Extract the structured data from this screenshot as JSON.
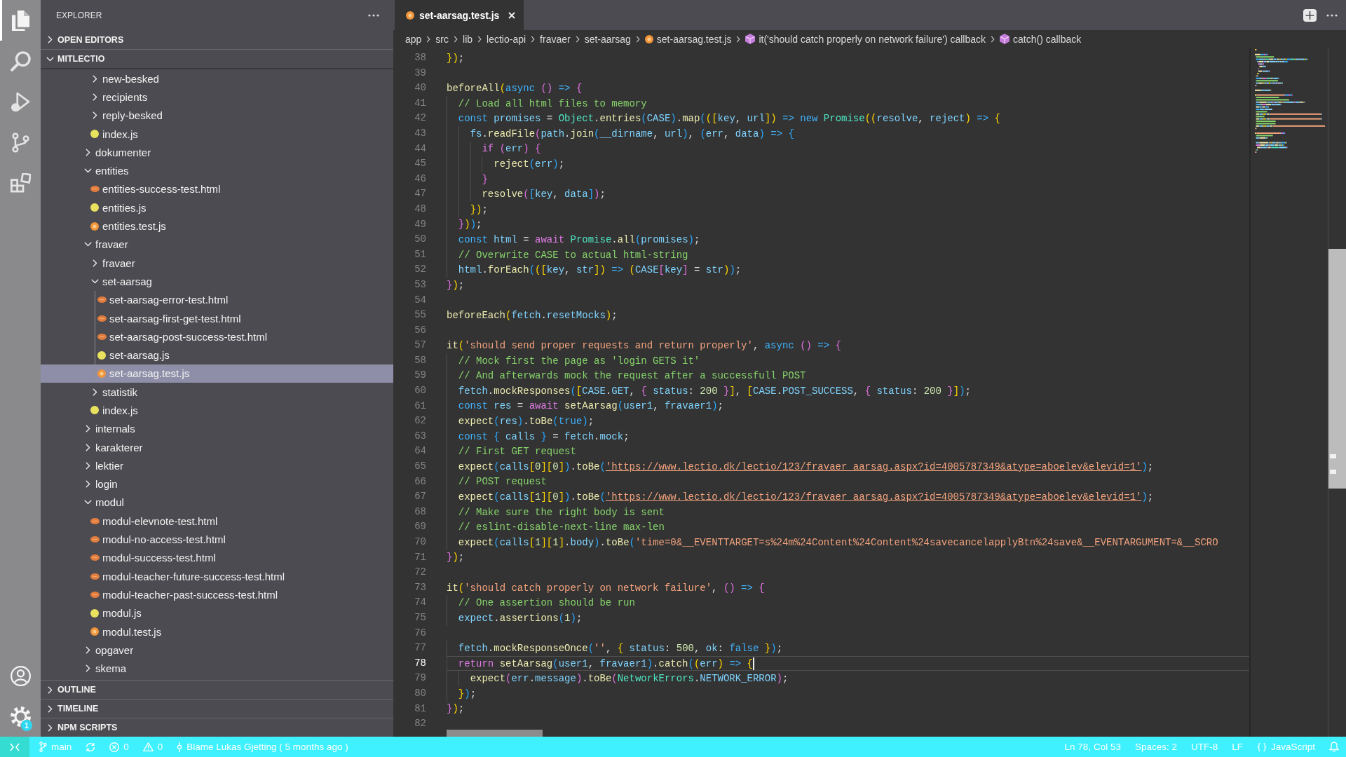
{
  "activity_bar": {
    "items": [
      {
        "kind": "files",
        "selected": true
      },
      {
        "kind": "search",
        "selected": false
      },
      {
        "kind": "debug",
        "selected": false
      },
      {
        "kind": "git",
        "selected": false
      },
      {
        "kind": "extensions",
        "selected": false
      }
    ],
    "bottom": [
      {
        "kind": "accounts"
      },
      {
        "kind": "settings",
        "badge": "1"
      }
    ]
  },
  "sidebar": {
    "title": "EXPLORER",
    "sections": [
      {
        "title": "OPEN EDITORS",
        "expanded": false
      },
      {
        "title": "MITLECTIO",
        "expanded": true,
        "tree": {
          "continued": [
            {
              "name": "new-besked",
              "kind": "folder",
              "expanded": false,
              "selected": false
            },
            {
              "name": "recipients",
              "kind": "folder",
              "expanded": false,
              "selected": false
            },
            {
              "name": "reply-besked",
              "kind": "folder",
              "expanded": false,
              "selected": false
            },
            {
              "name": "index.js",
              "kind": "js",
              "selected": false
            }
          ],
          "items": [
            {
              "name": "dokumenter",
              "kind": "folder",
              "expanded": false,
              "selected": false
            },
            {
              "name": "entities",
              "kind": "folder",
              "expanded": true,
              "selected": false,
              "children": [
                {
                  "name": "entities-success-test.html",
                  "kind": "html",
                  "selected": false
                },
                {
                  "name": "entities.js",
                  "kind": "js",
                  "selected": false
                },
                {
                  "name": "entities.test.js",
                  "kind": "test",
                  "selected": false
                }
              ]
            },
            {
              "name": "fravaer",
              "kind": "folder",
              "expanded": true,
              "selected": false,
              "children": [
                {
                  "name": "fravaer",
                  "kind": "folder",
                  "expanded": false,
                  "selected": false
                },
                {
                  "name": "set-aarsag",
                  "kind": "folder",
                  "expanded": true,
                  "selected": false,
                  "children": [
                    {
                      "name": "set-aarsag-error-test.html",
                      "kind": "html",
                      "selected": false
                    },
                    {
                      "name": "set-aarsag-first-get-test.html",
                      "kind": "html",
                      "selected": false
                    },
                    {
                      "name": "set-aarsag-post-success-test.html",
                      "kind": "html",
                      "selected": false
                    },
                    {
                      "name": "set-aarsag.js",
                      "kind": "js",
                      "selected": false
                    },
                    {
                      "name": "set-aarsag.test.js",
                      "kind": "test",
                      "selected": true
                    }
                  ]
                },
                {
                  "name": "statistik",
                  "kind": "folder",
                  "expanded": false,
                  "selected": false
                },
                {
                  "name": "index.js",
                  "kind": "js",
                  "selected": false
                }
              ]
            },
            {
              "name": "internals",
              "kind": "folder",
              "expanded": false,
              "selected": false
            },
            {
              "name": "karakterer",
              "kind": "folder",
              "expanded": false,
              "selected": false
            },
            {
              "name": "lektier",
              "kind": "folder",
              "expanded": false,
              "selected": false
            },
            {
              "name": "login",
              "kind": "folder",
              "expanded": false,
              "selected": false
            },
            {
              "name": "modul",
              "kind": "folder",
              "expanded": true,
              "selected": false,
              "children": [
                {
                  "name": "modul-elevnote-test.html",
                  "kind": "html",
                  "selected": false
                },
                {
                  "name": "modul-no-access-test.html",
                  "kind": "html",
                  "selected": false
                },
                {
                  "name": "modul-success-test.html",
                  "kind": "html",
                  "selected": false
                },
                {
                  "name": "modul-teacher-future-success-test.html",
                  "kind": "html",
                  "selected": false
                },
                {
                  "name": "modul-teacher-past-success-test.html",
                  "kind": "html",
                  "selected": false
                },
                {
                  "name": "modul.js",
                  "kind": "js",
                  "selected": false
                },
                {
                  "name": "modul.test.js",
                  "kind": "test",
                  "selected": false
                }
              ]
            },
            {
              "name": "opgaver",
              "kind": "folder",
              "expanded": false,
              "selected": false
            },
            {
              "name": "skema",
              "kind": "folder",
              "expanded": false,
              "selected": false
            }
          ]
        }
      },
      {
        "title": "OUTLINE",
        "expanded": false
      },
      {
        "title": "TIMELINE",
        "expanded": false
      },
      {
        "title": "NPM SCRIPTS",
        "expanded": false
      }
    ]
  },
  "editor": {
    "tabs": [
      {
        "label": "set-aarsag.test.js",
        "kind": "test",
        "selected": true
      }
    ],
    "breadcrumbs": [
      {
        "label": "app",
        "kind": "folder"
      },
      {
        "label": "src",
        "kind": "folder"
      },
      {
        "label": "lib",
        "kind": "folder"
      },
      {
        "label": "lectio-api",
        "kind": "folder"
      },
      {
        "label": "fravaer",
        "kind": "folder"
      },
      {
        "label": "set-aarsag",
        "kind": "folder"
      },
      {
        "label": "set-aarsag.test.js",
        "kind": "test"
      },
      {
        "label": "it('should catch properly on network failure') callback",
        "kind": "method"
      },
      {
        "label": "catch() callback",
        "kind": "method"
      }
    ],
    "lines": [
      {
        "number": "38",
        "current": false,
        "tokens": [
          {
            "kind": "br1",
            "text": "})"
          },
          {
            "kind": "p",
            "text": ";"
          }
        ]
      },
      {
        "number": "39",
        "current": false
      },
      {
        "number": "40",
        "current": false,
        "tokens": [
          {
            "kind": "fn",
            "text": "beforeAll"
          },
          {
            "kind": "br1",
            "text": "("
          },
          {
            "kind": "kw",
            "text": "async "
          },
          {
            "kind": "br2",
            "text": "() "
          },
          {
            "kind": "kw",
            "text": "=> "
          },
          {
            "kind": "br2",
            "text": "{"
          }
        ]
      },
      {
        "number": "41",
        "current": false,
        "tokens": [
          {
            "kind": "cmt",
            "text": "  // Load all html files to memory"
          }
        ]
      },
      {
        "number": "42",
        "current": false,
        "tokens": [
          {
            "kind": "kw",
            "text": "  const "
          },
          {
            "kind": "var",
            "text": "promises"
          },
          {
            "kind": "p",
            "text": " = "
          },
          {
            "kind": "type",
            "text": "Object"
          },
          {
            "kind": "p",
            "text": "."
          },
          {
            "kind": "fn",
            "text": "entries"
          },
          {
            "kind": "br3",
            "text": "("
          },
          {
            "kind": "var",
            "text": "CASE"
          },
          {
            "kind": "br3",
            "text": ")"
          },
          {
            "kind": "p",
            "text": "."
          },
          {
            "kind": "fn",
            "text": "map"
          },
          {
            "kind": "br3",
            "text": "("
          },
          {
            "kind": "br1",
            "text": "(["
          },
          {
            "kind": "var",
            "text": "key"
          },
          {
            "kind": "p",
            "text": ", "
          },
          {
            "kind": "var",
            "text": "url"
          },
          {
            "kind": "br1",
            "text": "]) "
          },
          {
            "kind": "kw",
            "text": "=> new "
          },
          {
            "kind": "type",
            "text": "Promise"
          },
          {
            "kind": "br1",
            "text": "(("
          },
          {
            "kind": "var",
            "text": "resolve"
          },
          {
            "kind": "p",
            "text": ", "
          },
          {
            "kind": "var",
            "text": "reject"
          },
          {
            "kind": "br1",
            "text": ") "
          },
          {
            "kind": "kw",
            "text": "=> "
          },
          {
            "kind": "br1",
            "text": "{"
          }
        ]
      },
      {
        "number": "43",
        "current": false,
        "tokens": [
          {
            "kind": "var",
            "text": "    fs"
          },
          {
            "kind": "p",
            "text": "."
          },
          {
            "kind": "fn",
            "text": "readFile"
          },
          {
            "kind": "br2",
            "text": "("
          },
          {
            "kind": "var",
            "text": "path"
          },
          {
            "kind": "p",
            "text": "."
          },
          {
            "kind": "fn",
            "text": "join"
          },
          {
            "kind": "br3",
            "text": "("
          },
          {
            "kind": "var",
            "text": "__dirname"
          },
          {
            "kind": "p",
            "text": ", "
          },
          {
            "kind": "var",
            "text": "url"
          },
          {
            "kind": "br3",
            "text": ")"
          },
          {
            "kind": "p",
            "text": ", "
          },
          {
            "kind": "br3",
            "text": "("
          },
          {
            "kind": "var",
            "text": "err"
          },
          {
            "kind": "p",
            "text": ", "
          },
          {
            "kind": "var",
            "text": "data"
          },
          {
            "kind": "br3",
            "text": ") "
          },
          {
            "kind": "kw",
            "text": "=> "
          },
          {
            "kind": "br3",
            "text": "{"
          }
        ]
      },
      {
        "number": "44",
        "current": false,
        "tokens": [
          {
            "kind": "ctrl",
            "text": "      if "
          },
          {
            "kind": "br2",
            "text": "("
          },
          {
            "kind": "var",
            "text": "err"
          },
          {
            "kind": "br2",
            "text": ") {"
          }
        ]
      },
      {
        "number": "45",
        "current": false,
        "tokens": [
          {
            "kind": "fn",
            "text": "        reject"
          },
          {
            "kind": "br3",
            "text": "("
          },
          {
            "kind": "var",
            "text": "err"
          },
          {
            "kind": "br3",
            "text": ")"
          },
          {
            "kind": "p",
            "text": ";"
          }
        ]
      },
      {
        "number": "46",
        "current": false,
        "tokens": [
          {
            "kind": "br2",
            "text": "      }"
          }
        ]
      },
      {
        "number": "47",
        "current": false,
        "tokens": [
          {
            "kind": "fn",
            "text": "      resolve"
          },
          {
            "kind": "br2",
            "text": "("
          },
          {
            "kind": "br3",
            "text": "["
          },
          {
            "kind": "var",
            "text": "key"
          },
          {
            "kind": "p",
            "text": ", "
          },
          {
            "kind": "var",
            "text": "data"
          },
          {
            "kind": "br3",
            "text": "]"
          },
          {
            "kind": "br2",
            "text": ")"
          },
          {
            "kind": "p",
            "text": ";"
          }
        ]
      },
      {
        "number": "48",
        "current": false,
        "tokens": [
          {
            "kind": "br1",
            "text": "    })"
          },
          {
            "kind": "p",
            "text": ";"
          }
        ]
      },
      {
        "number": "49",
        "current": false,
        "tokens": [
          {
            "kind": "br2",
            "text": "  }"
          },
          {
            "kind": "br1",
            "text": ")"
          },
          {
            "kind": "br3",
            "text": ")"
          },
          {
            "kind": "p",
            "text": ";"
          }
        ]
      },
      {
        "number": "50",
        "current": false,
        "tokens": [
          {
            "kind": "kw",
            "text": "  const "
          },
          {
            "kind": "var",
            "text": "html"
          },
          {
            "kind": "p",
            "text": " = "
          },
          {
            "kind": "ctrl",
            "text": "await "
          },
          {
            "kind": "type",
            "text": "Promise"
          },
          {
            "kind": "p",
            "text": "."
          },
          {
            "kind": "fn",
            "text": "all"
          },
          {
            "kind": "br3",
            "text": "("
          },
          {
            "kind": "var",
            "text": "promises"
          },
          {
            "kind": "br3",
            "text": ")"
          },
          {
            "kind": "p",
            "text": ";"
          }
        ]
      },
      {
        "number": "51",
        "current": false,
        "tokens": [
          {
            "kind": "cmt",
            "text": "  // Overwrite CASE to actual html-string"
          }
        ]
      },
      {
        "number": "52",
        "current": false,
        "tokens": [
          {
            "kind": "var",
            "text": "  html"
          },
          {
            "kind": "p",
            "text": "."
          },
          {
            "kind": "fn",
            "text": "forEach"
          },
          {
            "kind": "br3",
            "text": "("
          },
          {
            "kind": "br1",
            "text": "(["
          },
          {
            "kind": "var",
            "text": "key"
          },
          {
            "kind": "p",
            "text": ", "
          },
          {
            "kind": "var",
            "text": "str"
          },
          {
            "kind": "br1",
            "text": "]) "
          },
          {
            "kind": "kw",
            "text": "=> "
          },
          {
            "kind": "br1",
            "text": "("
          },
          {
            "kind": "var",
            "text": "CASE"
          },
          {
            "kind": "br2",
            "text": "["
          },
          {
            "kind": "var",
            "text": "key"
          },
          {
            "kind": "br2",
            "text": "]"
          },
          {
            "kind": "p",
            "text": " = "
          },
          {
            "kind": "var",
            "text": "str"
          },
          {
            "kind": "br1",
            "text": ")"
          },
          {
            "kind": "br3",
            "text": ")"
          },
          {
            "kind": "p",
            "text": ";"
          }
        ]
      },
      {
        "number": "53",
        "current": false,
        "tokens": [
          {
            "kind": "br2",
            "text": "}"
          },
          {
            "kind": "br1",
            "text": ")"
          },
          {
            "kind": "p",
            "text": ";"
          }
        ]
      },
      {
        "number": "54",
        "current": false
      },
      {
        "number": "55",
        "current": false,
        "tokens": [
          {
            "kind": "fn",
            "text": "beforeEach"
          },
          {
            "kind": "br1",
            "text": "("
          },
          {
            "kind": "var",
            "text": "fetch"
          },
          {
            "kind": "p",
            "text": "."
          },
          {
            "kind": "var",
            "text": "resetMocks"
          },
          {
            "kind": "br1",
            "text": ")"
          },
          {
            "kind": "p",
            "text": ";"
          }
        ]
      },
      {
        "number": "56",
        "current": false
      },
      {
        "number": "57",
        "current": false,
        "tokens": [
          {
            "kind": "fn",
            "text": "it"
          },
          {
            "kind": "br1",
            "text": "("
          },
          {
            "kind": "str",
            "text": "'should send proper requests and return properly'"
          },
          {
            "kind": "p",
            "text": ", "
          },
          {
            "kind": "kw",
            "text": "async "
          },
          {
            "kind": "br2",
            "text": "() "
          },
          {
            "kind": "kw",
            "text": "=> "
          },
          {
            "kind": "br2",
            "text": "{"
          }
        ]
      },
      {
        "number": "58",
        "current": false,
        "tokens": [
          {
            "kind": "cmt",
            "text": "  // Mock first the page as 'login GETS it'"
          }
        ]
      },
      {
        "number": "59",
        "current": false,
        "tokens": [
          {
            "kind": "cmt",
            "text": "  // And afterwards mock the request after a successfull POST"
          }
        ]
      },
      {
        "number": "60",
        "current": false,
        "tokens": [
          {
            "kind": "var",
            "text": "  fetch"
          },
          {
            "kind": "p",
            "text": "."
          },
          {
            "kind": "fn",
            "text": "mockResponses"
          },
          {
            "kind": "br3",
            "text": "("
          },
          {
            "kind": "br1",
            "text": "["
          },
          {
            "kind": "var",
            "text": "CASE"
          },
          {
            "kind": "p",
            "text": "."
          },
          {
            "kind": "var",
            "text": "GET"
          },
          {
            "kind": "p",
            "text": ", "
          },
          {
            "kind": "br2",
            "text": "{ "
          },
          {
            "kind": "var",
            "text": "status"
          },
          {
            "kind": "p",
            "text": ": "
          },
          {
            "kind": "num",
            "text": "200 "
          },
          {
            "kind": "br2",
            "text": "}"
          },
          {
            "kind": "br1",
            "text": "]"
          },
          {
            "kind": "p",
            "text": ", "
          },
          {
            "kind": "br1",
            "text": "["
          },
          {
            "kind": "var",
            "text": "CASE"
          },
          {
            "kind": "p",
            "text": "."
          },
          {
            "kind": "var",
            "text": "POST_SUCCESS"
          },
          {
            "kind": "p",
            "text": ", "
          },
          {
            "kind": "br2",
            "text": "{ "
          },
          {
            "kind": "var",
            "text": "status"
          },
          {
            "kind": "p",
            "text": ": "
          },
          {
            "kind": "num",
            "text": "200 "
          },
          {
            "kind": "br2",
            "text": "}"
          },
          {
            "kind": "br1",
            "text": "]"
          },
          {
            "kind": "br3",
            "text": ")"
          },
          {
            "kind": "p",
            "text": ";"
          }
        ]
      },
      {
        "number": "61",
        "current": false,
        "tokens": [
          {
            "kind": "kw",
            "text": "  const "
          },
          {
            "kind": "var",
            "text": "res"
          },
          {
            "kind": "p",
            "text": " = "
          },
          {
            "kind": "ctrl",
            "text": "await "
          },
          {
            "kind": "fn",
            "text": "setAarsag"
          },
          {
            "kind": "br3",
            "text": "("
          },
          {
            "kind": "var",
            "text": "user1"
          },
          {
            "kind": "p",
            "text": ", "
          },
          {
            "kind": "var",
            "text": "fravaer1"
          },
          {
            "kind": "br3",
            "text": ")"
          },
          {
            "kind": "p",
            "text": ";"
          }
        ]
      },
      {
        "number": "62",
        "current": false,
        "tokens": [
          {
            "kind": "fn",
            "text": "  expect"
          },
          {
            "kind": "br3",
            "text": "("
          },
          {
            "kind": "var",
            "text": "res"
          },
          {
            "kind": "br3",
            "text": ")"
          },
          {
            "kind": "p",
            "text": "."
          },
          {
            "kind": "fn",
            "text": "toBe"
          },
          {
            "kind": "br3",
            "text": "("
          },
          {
            "kind": "kw",
            "text": "true"
          },
          {
            "kind": "br3",
            "text": ")"
          },
          {
            "kind": "p",
            "text": ";"
          }
        ]
      },
      {
        "number": "63",
        "current": false,
        "tokens": [
          {
            "kind": "kw",
            "text": "  const "
          },
          {
            "kind": "br3",
            "text": "{ "
          },
          {
            "kind": "var",
            "text": "calls "
          },
          {
            "kind": "br3",
            "text": "}"
          },
          {
            "kind": "p",
            "text": " = "
          },
          {
            "kind": "var",
            "text": "fetch"
          },
          {
            "kind": "p",
            "text": "."
          },
          {
            "kind": "var",
            "text": "mock"
          },
          {
            "kind": "p",
            "text": ";"
          }
        ]
      },
      {
        "number": "64",
        "current": false,
        "tokens": [
          {
            "kind": "cmt",
            "text": "  // First GET request"
          }
        ]
      },
      {
        "number": "65",
        "current": false,
        "tokens": [
          {
            "kind": "fn",
            "text": "  expect"
          },
          {
            "kind": "br3",
            "text": "("
          },
          {
            "kind": "var",
            "text": "calls"
          },
          {
            "kind": "br1",
            "text": "["
          },
          {
            "kind": "num",
            "text": "0"
          },
          {
            "kind": "br1",
            "text": "]["
          },
          {
            "kind": "num",
            "text": "0"
          },
          {
            "kind": "br1",
            "text": "]"
          },
          {
            "kind": "br3",
            "text": ")"
          },
          {
            "kind": "p",
            "text": "."
          },
          {
            "kind": "fn",
            "text": "toBe"
          },
          {
            "kind": "br3",
            "text": "("
          },
          {
            "kind": "url",
            "text": "'https://www.lectio.dk/lectio/123/fravaer_aarsag.aspx?id=4005787349&atype=aboelev&elevid=1'"
          },
          {
            "kind": "br3",
            "text": ")"
          },
          {
            "kind": "p",
            "text": ";"
          }
        ]
      },
      {
        "number": "66",
        "current": false,
        "tokens": [
          {
            "kind": "cmt",
            "text": "  // POST request"
          }
        ]
      },
      {
        "number": "67",
        "current": false,
        "tokens": [
          {
            "kind": "fn",
            "text": "  expect"
          },
          {
            "kind": "br3",
            "text": "("
          },
          {
            "kind": "var",
            "text": "calls"
          },
          {
            "kind": "br1",
            "text": "["
          },
          {
            "kind": "num",
            "text": "1"
          },
          {
            "kind": "br1",
            "text": "]["
          },
          {
            "kind": "num",
            "text": "0"
          },
          {
            "kind": "br1",
            "text": "]"
          },
          {
            "kind": "br3",
            "text": ")"
          },
          {
            "kind": "p",
            "text": "."
          },
          {
            "kind": "fn",
            "text": "toBe"
          },
          {
            "kind": "br3",
            "text": "("
          },
          {
            "kind": "url",
            "text": "'https://www.lectio.dk/lectio/123/fravaer_aarsag.aspx?id=4005787349&atype=aboelev&elevid=1'"
          },
          {
            "kind": "br3",
            "text": ")"
          },
          {
            "kind": "p",
            "text": ";"
          }
        ]
      },
      {
        "number": "68",
        "current": false,
        "tokens": [
          {
            "kind": "cmt",
            "text": "  // Make sure the right body is sent"
          }
        ]
      },
      {
        "number": "69",
        "current": false,
        "tokens": [
          {
            "kind": "cmt",
            "text": "  // eslint-disable-next-line max-len"
          }
        ]
      },
      {
        "number": "70",
        "current": false,
        "tokens": [
          {
            "kind": "fn",
            "text": "  expect"
          },
          {
            "kind": "br3",
            "text": "("
          },
          {
            "kind": "var",
            "text": "calls"
          },
          {
            "kind": "br1",
            "text": "["
          },
          {
            "kind": "num",
            "text": "1"
          },
          {
            "kind": "br1",
            "text": "]["
          },
          {
            "kind": "num",
            "text": "1"
          },
          {
            "kind": "br1",
            "text": "]"
          },
          {
            "kind": "p",
            "text": "."
          },
          {
            "kind": "var",
            "text": "body"
          },
          {
            "kind": "br3",
            "text": ")"
          },
          {
            "kind": "p",
            "text": "."
          },
          {
            "kind": "fn",
            "text": "toBe"
          },
          {
            "kind": "br3",
            "text": "("
          },
          {
            "kind": "str",
            "text": "'time=0&__EVENTTARGET=s%24m%24Content%24Content%24savecancelapplyBtn%24save&__EVENTARGUMENT=&__SCRO"
          }
        ]
      },
      {
        "number": "71",
        "current": false,
        "tokens": [
          {
            "kind": "br2",
            "text": "}"
          },
          {
            "kind": "br1",
            "text": ")"
          },
          {
            "kind": "p",
            "text": ";"
          }
        ]
      },
      {
        "number": "72",
        "current": false
      },
      {
        "number": "73",
        "current": false,
        "tokens": [
          {
            "kind": "fn",
            "text": "it"
          },
          {
            "kind": "br1",
            "text": "("
          },
          {
            "kind": "str",
            "text": "'should catch properly on network failure'"
          },
          {
            "kind": "p",
            "text": ", "
          },
          {
            "kind": "br2",
            "text": "() "
          },
          {
            "kind": "kw",
            "text": "=> "
          },
          {
            "kind": "br2",
            "text": "{"
          }
        ]
      },
      {
        "number": "74",
        "current": false,
        "tokens": [
          {
            "kind": "cmt",
            "text": "  // One assertion should be run"
          }
        ]
      },
      {
        "number": "75",
        "current": false,
        "tokens": [
          {
            "kind": "var",
            "text": "  expect"
          },
          {
            "kind": "p",
            "text": "."
          },
          {
            "kind": "fn",
            "text": "assertions"
          },
          {
            "kind": "br3",
            "text": "("
          },
          {
            "kind": "num",
            "text": "1"
          },
          {
            "kind": "br3",
            "text": ")"
          },
          {
            "kind": "p",
            "text": ";"
          }
        ]
      },
      {
        "number": "76",
        "current": false
      },
      {
        "number": "77",
        "current": false,
        "tokens": [
          {
            "kind": "var",
            "text": "  fetch"
          },
          {
            "kind": "p",
            "text": "."
          },
          {
            "kind": "fn",
            "text": "mockResponseOnce"
          },
          {
            "kind": "br3",
            "text": "("
          },
          {
            "kind": "str",
            "text": "''"
          },
          {
            "kind": "p",
            "text": ", "
          },
          {
            "kind": "br1",
            "text": "{ "
          },
          {
            "kind": "var",
            "text": "status"
          },
          {
            "kind": "p",
            "text": ": "
          },
          {
            "kind": "num",
            "text": "500"
          },
          {
            "kind": "p",
            "text": ", "
          },
          {
            "kind": "var",
            "text": "ok"
          },
          {
            "kind": "p",
            "text": ": "
          },
          {
            "kind": "kw",
            "text": "false "
          },
          {
            "kind": "br1",
            "text": "}"
          },
          {
            "kind": "br3",
            "text": ")"
          },
          {
            "kind": "p",
            "text": ";"
          }
        ]
      },
      {
        "number": "78",
        "current": true,
        "tokens": [
          {
            "kind": "ctrl",
            "text": "  return "
          },
          {
            "kind": "fn",
            "text": "setAarsag"
          },
          {
            "kind": "br3",
            "text": "("
          },
          {
            "kind": "var",
            "text": "user1"
          },
          {
            "kind": "p",
            "text": ", "
          },
          {
            "kind": "var",
            "text": "fravaer1"
          },
          {
            "kind": "br3",
            "text": ")"
          },
          {
            "kind": "p",
            "text": "."
          },
          {
            "kind": "fn",
            "text": "catch"
          },
          {
            "kind": "br3",
            "text": "("
          },
          {
            "kind": "br1",
            "text": "("
          },
          {
            "kind": "var",
            "text": "err"
          },
          {
            "kind": "br1",
            "text": ") "
          },
          {
            "kind": "kw",
            "text": "=> "
          },
          {
            "kind": "br1",
            "text": "{"
          }
        ]
      },
      {
        "number": "79",
        "current": false,
        "tokens": [
          {
            "kind": "fn",
            "text": "    expect"
          },
          {
            "kind": "br2",
            "text": "("
          },
          {
            "kind": "var",
            "text": "err"
          },
          {
            "kind": "p",
            "text": "."
          },
          {
            "kind": "var",
            "text": "message"
          },
          {
            "kind": "br2",
            "text": ")"
          },
          {
            "kind": "p",
            "text": "."
          },
          {
            "kind": "fn",
            "text": "toBe"
          },
          {
            "kind": "br2",
            "text": "("
          },
          {
            "kind": "type",
            "text": "NetworkErrors"
          },
          {
            "kind": "p",
            "text": "."
          },
          {
            "kind": "var",
            "text": "NETWORK_ERROR"
          },
          {
            "kind": "br2",
            "text": ")"
          },
          {
            "kind": "p",
            "text": ";"
          }
        ]
      },
      {
        "number": "80",
        "current": false,
        "tokens": [
          {
            "kind": "br1",
            "text": "  }"
          },
          {
            "kind": "br3",
            "text": ")"
          },
          {
            "kind": "p",
            "text": ";"
          }
        ]
      },
      {
        "number": "81",
        "current": false,
        "tokens": [
          {
            "kind": "br2",
            "text": "}"
          },
          {
            "kind": "br1",
            "text": ")"
          },
          {
            "kind": "p",
            "text": ";"
          }
        ]
      },
      {
        "number": "82",
        "current": false
      }
    ]
  },
  "status_bar": {
    "left": [
      {
        "kind": "remote"
      },
      {
        "kind": "branch",
        "text": "main"
      },
      {
        "kind": "sync"
      },
      {
        "kind": "errors",
        "text": "0"
      },
      {
        "kind": "warnings",
        "text": "0"
      },
      {
        "kind": "blame",
        "text": "Blame Lukas Gjetting ( 5 months ago )"
      }
    ],
    "right": [
      {
        "kind": "position",
        "text": "Ln 78, Col 53"
      },
      {
        "kind": "indentation",
        "text": "Spaces: 2"
      },
      {
        "kind": "encoding",
        "text": "UTF-8"
      },
      {
        "kind": "eol",
        "text": "LF"
      },
      {
        "kind": "language",
        "text": "JavaScript"
      },
      {
        "kind": "feedback"
      }
    ]
  }
}
